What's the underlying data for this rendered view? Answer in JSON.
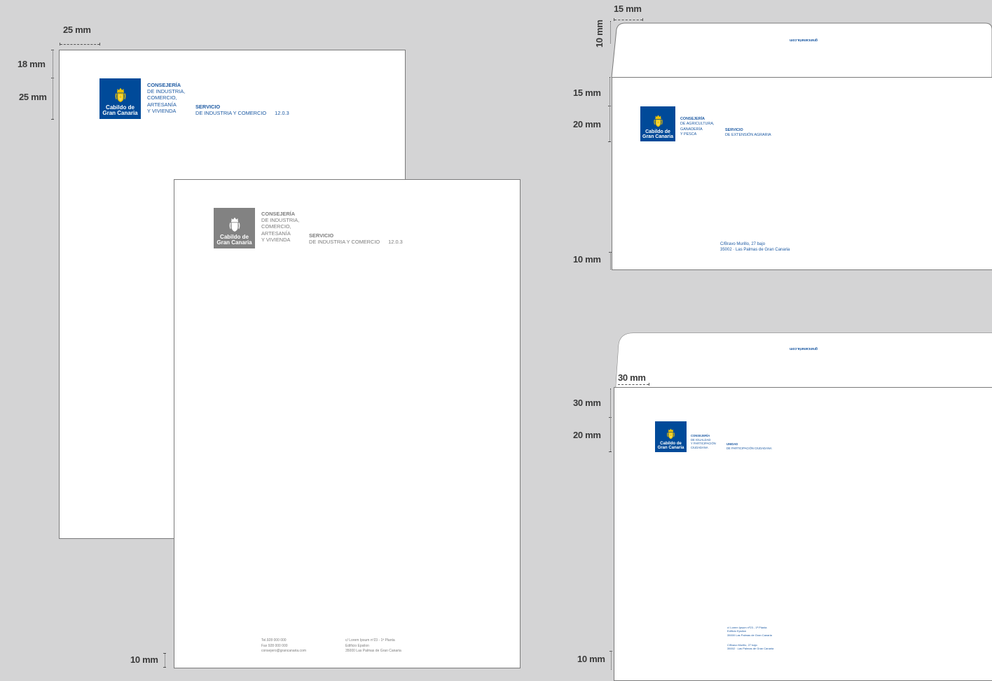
{
  "colors": {
    "background": "#d4d4d5",
    "brand_blue": "#004a99",
    "brand_yellow": "#f2c500",
    "gray_logo": "#828282",
    "blue_text": "#1d5aa3",
    "gray_text": "#7c7c7c"
  },
  "logo": {
    "line1": "Cabildo de",
    "line2": "Gran Canaria",
    "icon": "coat-of-arms-icon"
  },
  "letter_color": {
    "dims": {
      "left_margin": "25 mm",
      "top_margin": "18 mm",
      "logo_height": "25 mm"
    },
    "consejeria": {
      "title": "CONSEJERÍA",
      "l1": "DE INDUSTRIA,",
      "l2": "COMERCIO,",
      "l3": "ARTESANÍA",
      "l4": "Y VIVIENDA"
    },
    "servicio": {
      "title": "SERVICIO",
      "sub": "DE INDUSTRIA Y COMERCIO",
      "code": "12.0.3"
    }
  },
  "letter_gray": {
    "dims": {
      "bottom_margin": "10 mm"
    },
    "consejeria": {
      "title": "CONSEJERÍA",
      "l1": "DE INDUSTRIA,",
      "l2": "COMERCIO,",
      "l3": "ARTESANÍA",
      "l4": "Y VIVIENDA"
    },
    "servicio": {
      "title": "SERVICIO",
      "sub": "DE INDUSTRIA Y COMERCIO",
      "code": "12.0.3"
    },
    "footer_left": {
      "tel": "Tel.928 000 000",
      "fax": "Fax 928 000 000",
      "email": "consejero@grancanaria.com"
    },
    "footer_right": {
      "l1": "c/ Lorem Ipsum nº23 - 1ª Planta",
      "l2": "Edificio Epsilon",
      "l3": "35000 Las Palmas de Gran Canaria"
    }
  },
  "envelope1": {
    "dims": {
      "flap_left": "15 mm",
      "flap_height": "10 mm",
      "top": "15 mm",
      "logo_height": "20 mm",
      "bottom": "10 mm"
    },
    "flap_text": "grancanaria.com",
    "consejeria": {
      "title": "CONSEJERÍA",
      "l1": "DE AGRICULTURA,",
      "l2": "GANADERÍA",
      "l3": "Y PESCA"
    },
    "servicio": {
      "title": "SERVICIO",
      "sub": "DE EXTENSIÓN AGRARIA"
    },
    "address": {
      "l1": "C/Bravo Murillo, 27 bajo",
      "l2": "35002 · Las Palmas de Gran Canaria"
    }
  },
  "envelope2": {
    "dims": {
      "left": "30 mm",
      "top": "30 mm",
      "logo_height": "20 mm",
      "bottom": "10 mm"
    },
    "flap_text": "grancanaria.com",
    "consejeria": {
      "title": "CONSEJERÍA",
      "l1": "DE IGUALDAD",
      "l2": "Y PARTICIPACIÓN",
      "l3": "CIUDADANA"
    },
    "unidad": {
      "title": "UNIDAD",
      "sub": "DE PARTICIPACIÓN CIUDADANA"
    },
    "address1": {
      "l1": "c/ Lorem Ipsum nº23 - 1ª Planta",
      "l2": "Edificio Epsilon",
      "l3": "35000 Las Palmas de Gran Canaria"
    },
    "address2": {
      "l1": "C/Bravo Murillo, 27 bajo",
      "l2": "35002 · Las Palmas de Gran Canaria"
    }
  }
}
